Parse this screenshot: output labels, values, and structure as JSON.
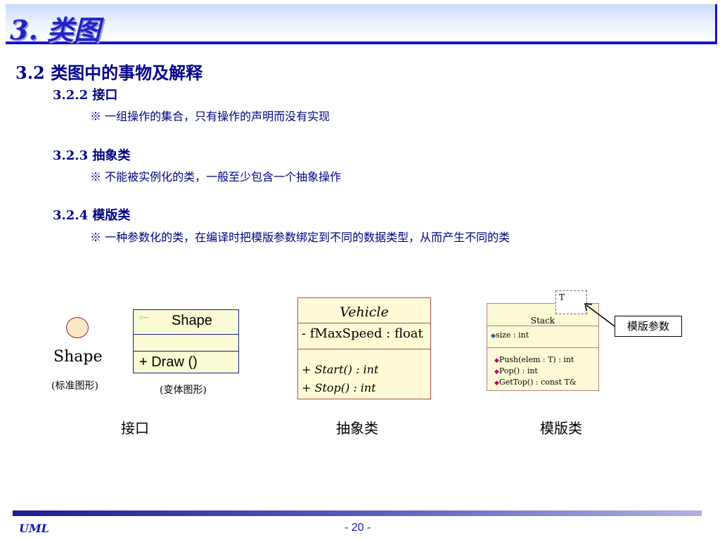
{
  "title": "3. 类图",
  "section_heading": "3.2 类图中的事物及解释",
  "items": [
    {
      "heading": "3.2.2 接口",
      "description": "※ 一组操作的集合，只有操作的声明而没有实现"
    },
    {
      "heading": "3.2.3 抽象类",
      "description": "※ 不能被实例化的类，一般至少包含一个抽象操作"
    },
    {
      "heading": "3.2.4 模版类",
      "description": "※ 一种参数化的类，在编译时把模版参数绑定到不同的数据类型，从而产生不同的类"
    }
  ],
  "interface_diagram": {
    "standard_label": "Shape",
    "standard_caption": "(标准图形)",
    "variant_name": "Shape",
    "variant_operation": "+  Draw ()",
    "variant_caption": "(变体图形)",
    "caption": "接口"
  },
  "abstract_class_diagram": {
    "name": "Vehicle",
    "attribute": "- fMaxSpeed : float",
    "operations": [
      "+ Start() : int",
      "+ Stop() : int"
    ],
    "caption": "抽象类"
  },
  "template_class_diagram": {
    "template_param": "T",
    "name": "Stack",
    "attribute": "size : int",
    "operations": [
      "Push(elem : T) : int",
      "Pop() : int",
      "GetTop() : const T&"
    ],
    "callout": "模版参数",
    "caption": "模版类"
  },
  "footer": {
    "left": "UML",
    "page": "- 20 -"
  }
}
